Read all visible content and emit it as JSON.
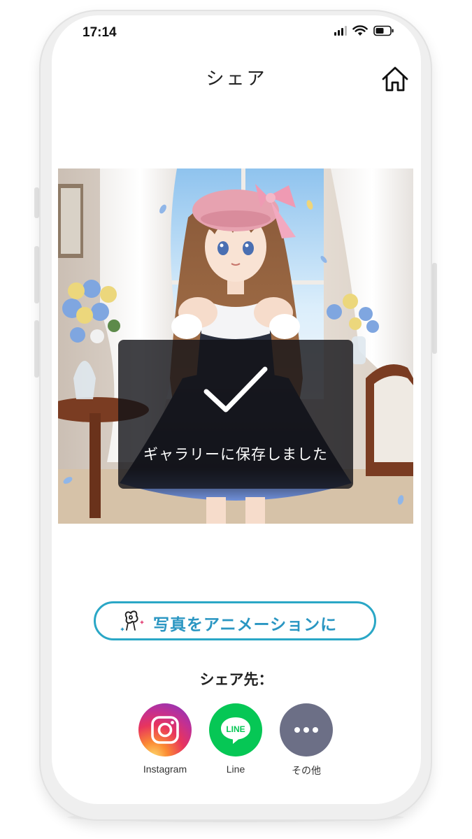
{
  "status_bar": {
    "time": "17:14"
  },
  "header": {
    "title": "シェア",
    "home_icon": "home-icon"
  },
  "image": {
    "description_icon": "generated-anime-image"
  },
  "toast": {
    "icon": "checkmark-icon",
    "message": "ギャラリーに保存しました"
  },
  "animate_button": {
    "label": "写真をアニメーションに",
    "icon": "animation-sparkle-icon",
    "color": "#2aa7c6"
  },
  "share": {
    "heading": "シェア先：",
    "targets": [
      {
        "label": "Instagram",
        "icon": "instagram-icon"
      },
      {
        "label": "Line",
        "icon": "line-icon",
        "badge_text": "LINE",
        "color": "#06c755"
      },
      {
        "label": "その他",
        "icon": "more-icon",
        "color": "#6c6f86"
      }
    ]
  }
}
